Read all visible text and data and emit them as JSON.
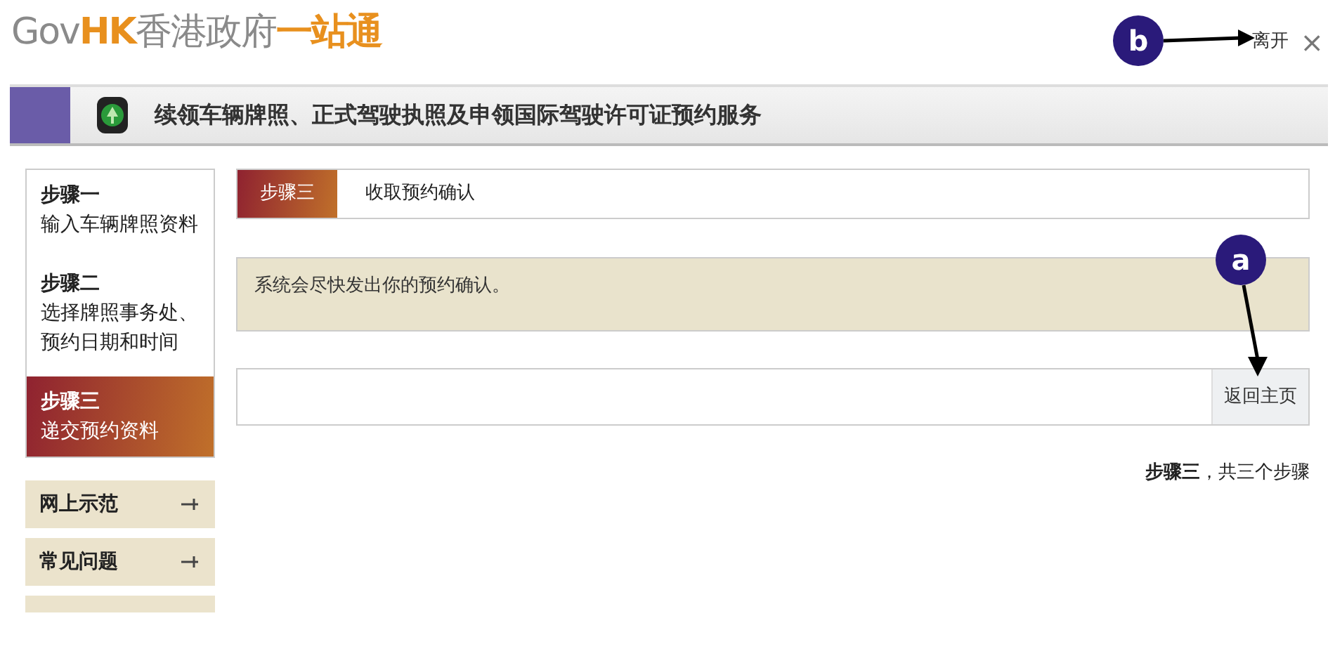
{
  "header": {
    "logo": [
      {
        "text": "Gov",
        "kind": "plain"
      },
      {
        "text": "HK",
        "kind": "accent"
      },
      {
        "text": "香港政府",
        "kind": "plain"
      },
      {
        "text": "一站通",
        "kind": "accent"
      }
    ],
    "leave_link": "离开",
    "close": "×"
  },
  "banner": {
    "title": "续领车辆牌照、正式驾驶执照及申领国际驾驶许可证预约服务"
  },
  "steps": [
    {
      "title": "步骤一",
      "text": "输入车辆牌照资料",
      "selected": false
    },
    {
      "title": "步骤二",
      "text": "选择牌照事务处、预约日期和时间",
      "selected": false
    },
    {
      "title": "步骤三",
      "text": "递交预约资料",
      "selected": true
    }
  ],
  "menu": [
    {
      "kind": "item",
      "label": "网上示范"
    },
    {
      "kind": "item",
      "label": "常见问题"
    },
    {
      "kind": "cut"
    }
  ],
  "step_header": {
    "step": "步骤三",
    "title": "收取预约确认"
  },
  "message": "系统会尽快发出你的预约确认。",
  "home_button": "返回主页",
  "progress": "**步骤三**，共三个步骤",
  "callouts": [
    {
      "label": "b"
    },
    {
      "label": "a"
    }
  ]
}
